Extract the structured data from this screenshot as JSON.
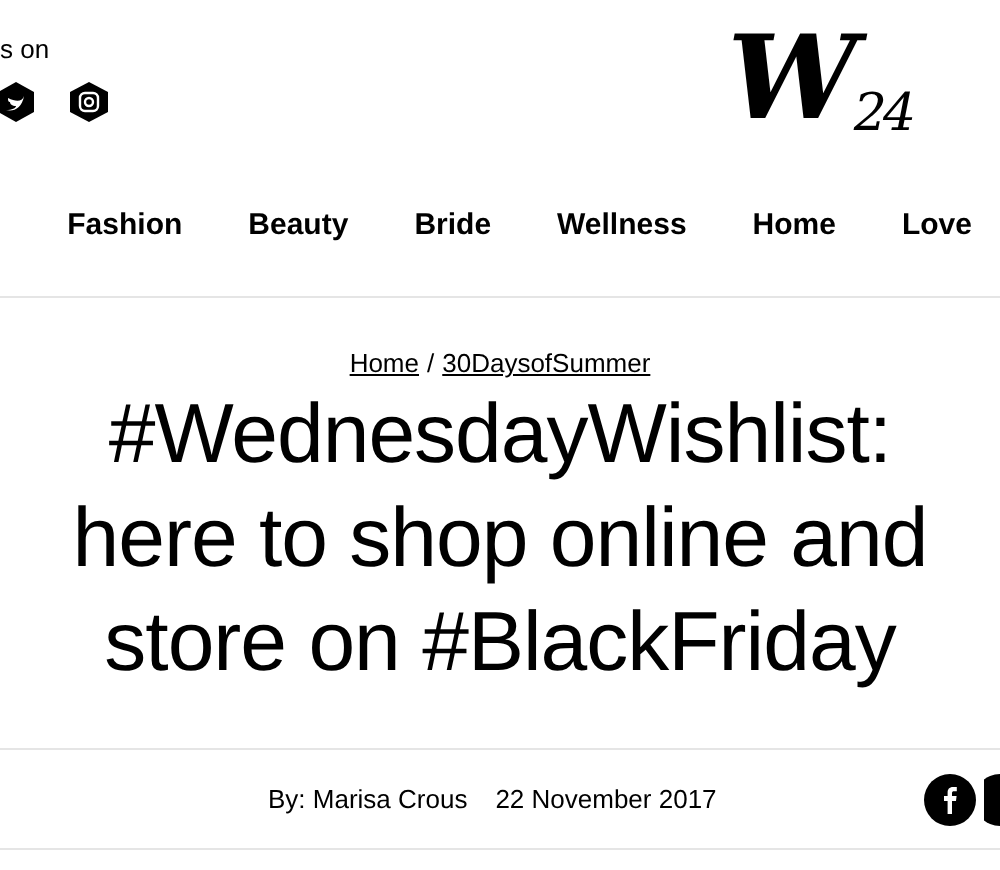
{
  "header": {
    "follow_text": "s on",
    "logo": "W$_{24}$"
  },
  "nav": [
    {
      "label": "Fashion"
    },
    {
      "label": "Beauty"
    },
    {
      "label": "Bride"
    },
    {
      "label": "Wellness"
    },
    {
      "label": "Home"
    },
    {
      "label": "Love"
    }
  ],
  "breadcrumb": [
    {
      "label": "Home"
    },
    {
      "label": "30DaysofSummer"
    }
  ],
  "breadcrumb_separator": "/",
  "title_lines": [
    "#WednesdayWishlist:",
    "here to shop online and",
    "store on #BlackFriday"
  ],
  "byline": {
    "author": "By: Marisa Crous",
    "date": "22 November 2017"
  }
}
